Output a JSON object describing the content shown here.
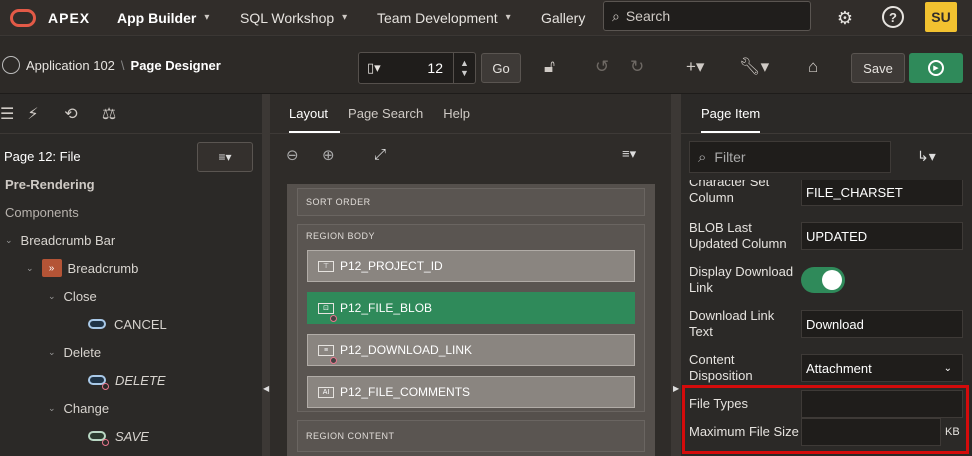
{
  "topnav": {
    "brand": "APEX",
    "items": [
      {
        "label": "App Builder",
        "active": true
      },
      {
        "label": "SQL Workshop"
      },
      {
        "label": "Team Development"
      },
      {
        "label": "Gallery"
      }
    ],
    "search_placeholder": "Search",
    "avatar": "SU"
  },
  "toolbar": {
    "application": "Application 102",
    "separator": "\\",
    "page_designer": "Page Designer",
    "page_number": "12",
    "go_label": "Go",
    "save_label": "Save"
  },
  "left": {
    "page_title": "Page 12: File",
    "tree": [
      {
        "label": "Pre-Rendering"
      },
      {
        "label": "Components"
      },
      {
        "label": "Breadcrumb Bar"
      },
      {
        "label": "Breadcrumb"
      },
      {
        "label": "Close"
      },
      {
        "label": "CANCEL"
      },
      {
        "label": "Delete"
      },
      {
        "label": "DELETE"
      },
      {
        "label": "Change"
      },
      {
        "label": "SAVE"
      }
    ]
  },
  "center": {
    "tabs": [
      "Layout",
      "Page Search",
      "Help"
    ],
    "regions": {
      "sort_order": "SORT ORDER",
      "region_body": "REGION BODY",
      "region_content": "REGION CONTENT"
    },
    "items": [
      "P12_PROJECT_ID",
      "P12_FILE_BLOB",
      "P12_DOWNLOAD_LINK",
      "P12_FILE_COMMENTS"
    ]
  },
  "right": {
    "tab": "Page Item",
    "filter_placeholder": "Filter",
    "properties": [
      {
        "label": "Character Set Column",
        "value": "FILE_CHARSET"
      },
      {
        "label": "BLOB Last Updated Column",
        "value": "UPDATED"
      },
      {
        "label": "Display Download Link",
        "value": "on"
      },
      {
        "label": "Download Link Text",
        "value": "Download"
      },
      {
        "label": "Content Disposition",
        "value": "Attachment"
      },
      {
        "label": "File Types",
        "value": ""
      },
      {
        "label": "Maximum File Size",
        "value": ""
      }
    ],
    "size_unit": "KB"
  },
  "colors": {
    "accent_green": "#2f8a5a",
    "highlight_red": "#d40b0b",
    "avatar_yellow": "#f2c230"
  }
}
